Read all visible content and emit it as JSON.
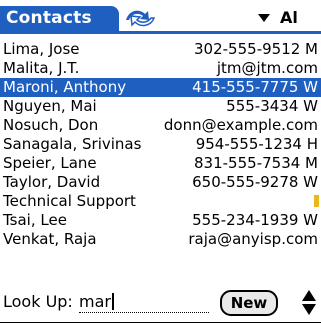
{
  "app": {
    "title": "Contacts",
    "category": "Al",
    "sync_icon": "hotsync-icon",
    "accent_color": "#1f5fbf",
    "note_color": "#e7b91c"
  },
  "contacts": [
    {
      "name": "Lima, Jose",
      "value": "302-555-9512 M",
      "selected": false
    },
    {
      "name": "Malita, J.T.",
      "value": "jtm@jtm.com",
      "selected": false
    },
    {
      "name": "Maroni, Anthony",
      "value": "415-555-7775 W",
      "selected": true
    },
    {
      "name": "Nguyen, Mai",
      "value": "555-3434 W",
      "selected": false
    },
    {
      "name": "Nosuch, Don",
      "value": "donn@example.com",
      "selected": false
    },
    {
      "name": "Sanagala, Srivinas",
      "value": "954-555-1234 H",
      "selected": false
    },
    {
      "name": "Speier, Lane",
      "value": "831-555-7534 M",
      "selected": false
    },
    {
      "name": "Taylor, David",
      "value": "650-555-9278 W",
      "selected": false
    },
    {
      "name": "Technical Support",
      "value": "",
      "selected": false,
      "has_note": true
    },
    {
      "name": "Tsai, Lee",
      "value": "555-234-1939 W",
      "selected": false
    },
    {
      "name": "Venkat, Raja",
      "value": "raja@anyisp.com",
      "selected": false
    }
  ],
  "lookup": {
    "label": "Look Up:",
    "value": "mar"
  },
  "buttons": {
    "new_label": "New"
  }
}
